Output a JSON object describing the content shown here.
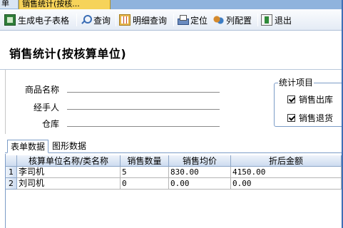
{
  "tabs": {
    "left_label": "单",
    "active_label": "销售统计(按核..."
  },
  "toolbar": {
    "items": [
      {
        "label": "生成电子表格",
        "icon": "excel-icon"
      },
      {
        "label": "查询",
        "icon": "search-icon"
      },
      {
        "label": "明细查询",
        "icon": "grid-icon"
      },
      {
        "label": "定位",
        "icon": "printer-icon"
      },
      {
        "label": "列配置",
        "icon": "columns-icon"
      },
      {
        "label": "退出",
        "icon": "exit-icon"
      }
    ]
  },
  "page_title": "销售统计(按核算单位)",
  "filters": {
    "product_label": "商品名称",
    "handler_label": "经手人",
    "warehouse_label": "仓库"
  },
  "stats": {
    "legend": "统计项目",
    "out_label": "销售出库",
    "return_label": "销售退货",
    "out_checked": true,
    "return_checked": true
  },
  "view_tabs": [
    "表单数据",
    "图形数据"
  ],
  "table": {
    "columns": [
      "核算单位名称/类名称",
      "销售数量",
      "销售均价",
      "折后金额"
    ],
    "rows": [
      {
        "index": "1",
        "name": "李司机",
        "qty": "5",
        "price": "830.00",
        "amount": "4150.00"
      },
      {
        "index": "2",
        "name": "刘司机",
        "qty": "0",
        "price": "0.00",
        "amount": "0.00"
      }
    ]
  },
  "colors": {
    "active_tab": "#f6d35a",
    "accent_border": "#7c9cc7"
  }
}
